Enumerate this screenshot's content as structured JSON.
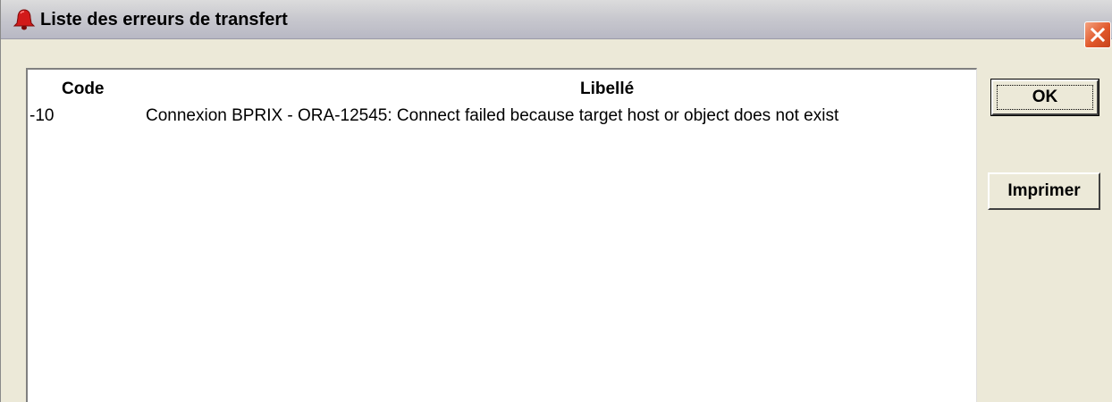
{
  "window": {
    "title": "Liste des erreurs de transfert",
    "icon": "bell-icon",
    "close_icon": "close-icon"
  },
  "table": {
    "columns": [
      "Code",
      "Libellé"
    ],
    "rows": [
      {
        "code": "-10",
        "libelle": "Connexion BPRIX - ORA-12545: Connect failed because target host or object does not exist"
      }
    ]
  },
  "buttons": {
    "ok_label": "OK",
    "print_label": "Imprimer"
  },
  "colors": {
    "close_button": "#e0572a",
    "window_bg": "#ece9d8",
    "icon_red": "#d21a1a"
  }
}
